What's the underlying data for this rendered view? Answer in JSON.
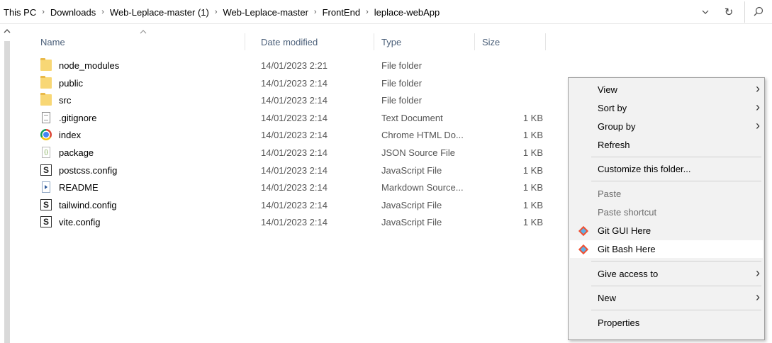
{
  "address_bar": {
    "crumbs": [
      "This PC",
      "Downloads",
      "Web-Leplace-master (1)",
      "Web-Leplace-master",
      "FrontEnd",
      "leplace-webApp"
    ],
    "separator": "›",
    "dropdown_glyph": "⌄",
    "refresh_glyph": "↻",
    "search_icon": "search-icon"
  },
  "columns": {
    "name": "Name",
    "date_modified": "Date modified",
    "type": "Type",
    "size": "Size"
  },
  "files": [
    {
      "name": "node_modules",
      "date": "14/01/2023 2:21",
      "type": "File folder",
      "size": "",
      "icon": "folder-icon"
    },
    {
      "name": "public",
      "date": "14/01/2023 2:14",
      "type": "File folder",
      "size": "",
      "icon": "folder-icon"
    },
    {
      "name": "src",
      "date": "14/01/2023 2:14",
      "type": "File folder",
      "size": "",
      "icon": "folder-icon"
    },
    {
      "name": ".gitignore",
      "date": "14/01/2023 2:14",
      "type": "Text Document",
      "size": "1 KB",
      "icon": "text-file-icon"
    },
    {
      "name": "index",
      "date": "14/01/2023 2:14",
      "type": "Chrome HTML Do...",
      "size": "1 KB",
      "icon": "chrome-icon"
    },
    {
      "name": "package",
      "date": "14/01/2023 2:14",
      "type": "JSON Source File",
      "size": "1 KB",
      "icon": "json-file-icon"
    },
    {
      "name": "postcss.config",
      "date": "14/01/2023 2:14",
      "type": "JavaScript File",
      "size": "1 KB",
      "icon": "js-file-icon"
    },
    {
      "name": "README",
      "date": "14/01/2023 2:14",
      "type": "Markdown Source...",
      "size": "1 KB",
      "icon": "markdown-file-icon"
    },
    {
      "name": "tailwind.config",
      "date": "14/01/2023 2:14",
      "type": "JavaScript File",
      "size": "1 KB",
      "icon": "js-file-icon"
    },
    {
      "name": "vite.config",
      "date": "14/01/2023 2:14",
      "type": "JavaScript File",
      "size": "1 KB",
      "icon": "js-file-icon"
    }
  ],
  "context_menu": {
    "view": "View",
    "sort_by": "Sort by",
    "group_by": "Group by",
    "refresh": "Refresh",
    "customize": "Customize this folder...",
    "paste": "Paste",
    "paste_shortcut": "Paste shortcut",
    "git_gui": "Git GUI Here",
    "git_bash": "Git Bash Here",
    "give_access": "Give access to",
    "new": "New",
    "properties": "Properties",
    "submenu_arrow": "›"
  }
}
